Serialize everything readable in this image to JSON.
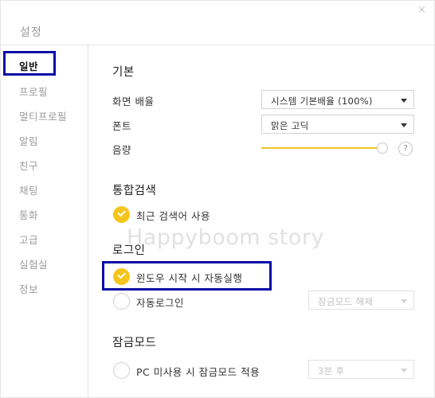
{
  "window": {
    "title": "설정",
    "close_glyph": "×"
  },
  "sidebar": {
    "items": [
      {
        "label": "일반",
        "active": true
      },
      {
        "label": "프로필"
      },
      {
        "label": "멀티프로필"
      },
      {
        "label": "알림"
      },
      {
        "label": "친구"
      },
      {
        "label": "채팅"
      },
      {
        "label": "통화"
      },
      {
        "label": "고급"
      },
      {
        "label": "실험실"
      },
      {
        "label": "정보"
      }
    ]
  },
  "basic": {
    "title": "기본",
    "scale_label": "화면 배율",
    "scale_value": "시스템 기본배율 (100%)",
    "font_label": "폰트",
    "font_value": "맑은 고딕",
    "volume_label": "음량",
    "volume_level": 1.0,
    "help_glyph": "?"
  },
  "search": {
    "title": "통합검색",
    "recent_label": "최근 검색어 사용",
    "recent_checked": true
  },
  "login": {
    "title": "로그인",
    "startup_label": "윈도우 시작 시 자동실행",
    "startup_checked": true,
    "autologin_label": "자동로그인",
    "autologin_checked": false,
    "lock_release_value": "잠금모드 해제"
  },
  "lock": {
    "title": "잠금모드",
    "idle_label": "PC 미사용 시 잠금모드 적용",
    "idle_checked": false,
    "idle_value": "3분 후"
  },
  "watermark": "Happyboom story",
  "colors": {
    "accent": "#f6c51d",
    "annotation_box": "#0a0aa8",
    "muted_text": "#9b9b9b"
  }
}
